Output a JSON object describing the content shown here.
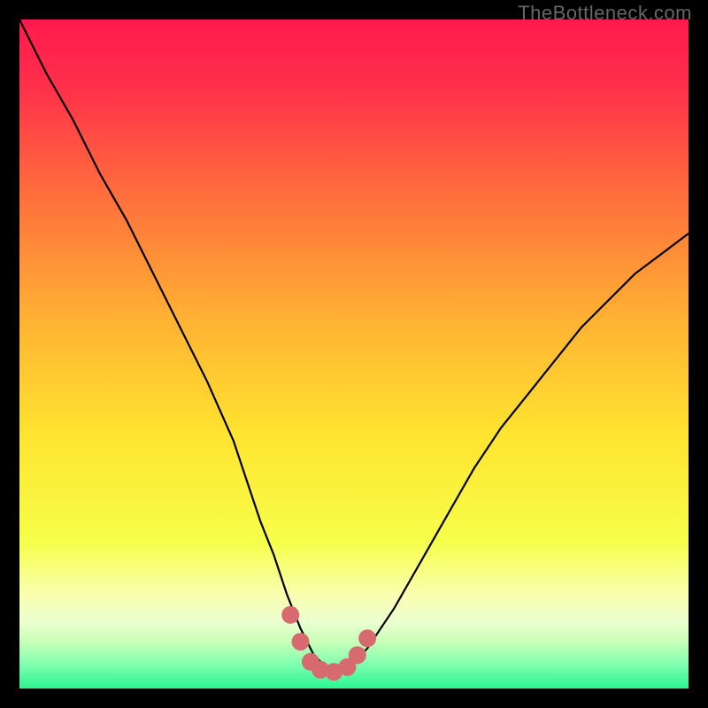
{
  "watermark": "TheBottleneck.com",
  "colors": {
    "curve": "#000000",
    "dots": "#d66a6f"
  },
  "chart_data": {
    "type": "line",
    "title": "",
    "xlabel": "",
    "ylabel": "",
    "xlim": [
      0,
      100
    ],
    "ylim": [
      0,
      100
    ],
    "x": [
      0,
      4,
      8,
      12,
      16,
      20,
      24,
      28,
      32,
      34,
      36,
      38,
      40,
      42,
      44,
      46,
      48,
      50,
      52,
      56,
      60,
      64,
      68,
      72,
      76,
      80,
      84,
      88,
      92,
      96,
      100
    ],
    "values": [
      100,
      92,
      85,
      77,
      70,
      62,
      54,
      46,
      37,
      31,
      25,
      20,
      14,
      9,
      5,
      3,
      3,
      4,
      6,
      12,
      19,
      26,
      33,
      39,
      44,
      49,
      54,
      58,
      62,
      65,
      68
    ],
    "highlight_dots": [
      {
        "x": 40.5,
        "y": 11
      },
      {
        "x": 42,
        "y": 7
      },
      {
        "x": 43.5,
        "y": 4
      },
      {
        "x": 45,
        "y": 2.8
      },
      {
        "x": 47,
        "y": 2.5
      },
      {
        "x": 49,
        "y": 3.2
      },
      {
        "x": 50.5,
        "y": 5
      },
      {
        "x": 52,
        "y": 7.5
      }
    ],
    "dot_radius": 10
  }
}
